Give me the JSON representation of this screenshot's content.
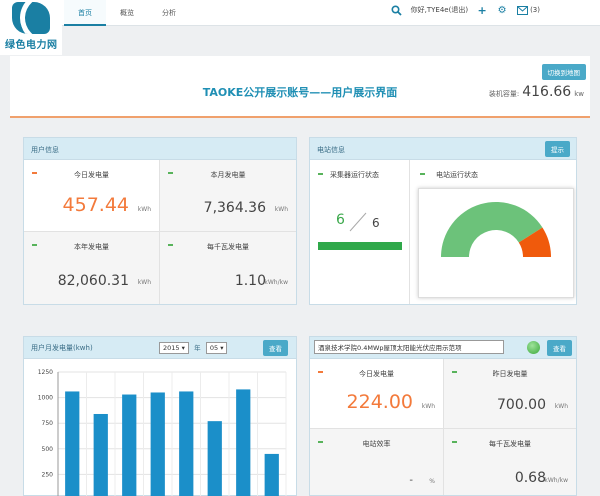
{
  "logo": {
    "text": "绿色电力网"
  },
  "nav": [
    {
      "label": "首页"
    },
    {
      "label": "概览"
    },
    {
      "label": "分析"
    }
  ],
  "user": {
    "greeting": "你好,TYE4e(退出)",
    "message_count": "(3)"
  },
  "banner": {
    "title": "TAOKE公开展示账号——用户展示界面",
    "map_button": "切换到地图",
    "capacity_label": "装机容量:",
    "capacity_value": "416.66",
    "capacity_unit": "kw"
  },
  "user_info": {
    "title": "用户信息",
    "today_label": "今日发电量",
    "today_value": "457.44",
    "today_unit": "kWh",
    "month_label": "本月发电量",
    "month_value": "7,364.36",
    "month_unit": "kWh",
    "year_label": "本年发电量",
    "year_value": "82,060.31",
    "year_unit": "kWh",
    "perkw_label": "每千瓦发电量",
    "perkw_value": "1.10",
    "perkw_unit": "kWh/kw"
  },
  "station_info": {
    "title": "电站信息",
    "alarm_button": "提示",
    "collector_label": "采集器运行状态",
    "collector_online": "6",
    "collector_total": "6",
    "station_status_label": "电站运行状态",
    "gauge_fraction": 0.82
  },
  "monthly": {
    "title": "用户月发电量(kwh)",
    "year": "2015",
    "year_label": "年",
    "month": "05",
    "query_button": "查看"
  },
  "chart_data": {
    "type": "bar",
    "categories": [
      "1",
      "2",
      "3",
      "4",
      "5",
      "6",
      "7",
      "8"
    ],
    "values": [
      1060,
      840,
      1030,
      1050,
      1060,
      770,
      1080,
      450
    ],
    "ylim": [
      0,
      1250
    ],
    "yticks": [
      250,
      500,
      750,
      1000,
      1250
    ],
    "color": "#1b8fc9"
  },
  "station_detail": {
    "station_name": "酒泉技术学院0.4MWp屋顶太阳能光伏应用示范项",
    "query_button": "查看",
    "today_label": "今日发电量",
    "today_value": "224.00",
    "today_unit": "kWh",
    "yesterday_label": "昨日发电量",
    "yesterday_value": "700.00",
    "yesterday_unit": "kWh",
    "efficiency_label": "电站效率",
    "efficiency_value": "-",
    "efficiency_unit": "%",
    "perkw_label": "每千瓦发电量",
    "perkw_value": "0.68",
    "perkw_unit": "kWh/kw"
  }
}
